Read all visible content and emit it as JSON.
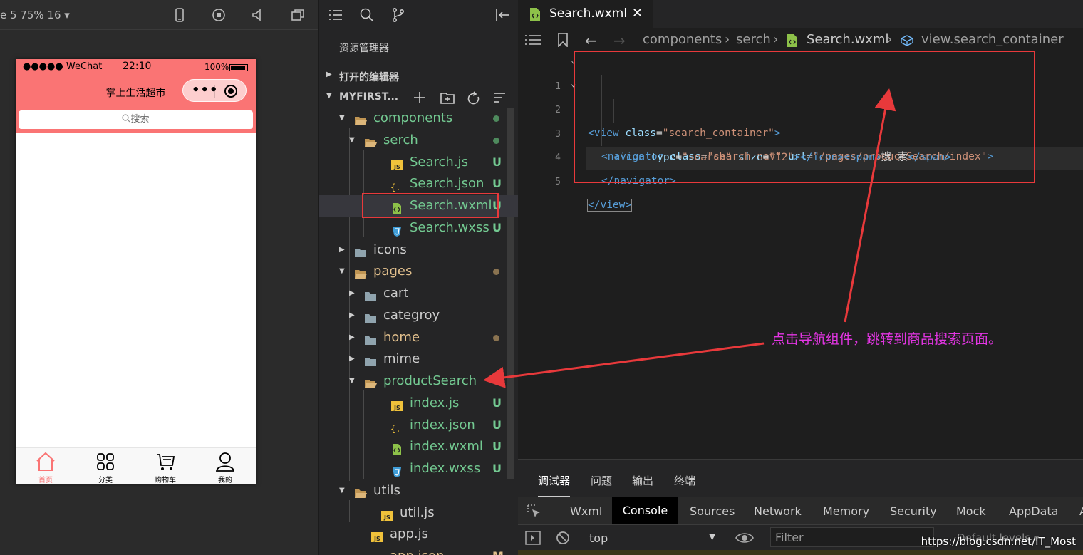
{
  "simulator": {
    "device_label": "e 5 75% 16 ▾",
    "status": {
      "carrier": "●●●●● WeChat",
      "time": "22:10",
      "battery": "100%"
    },
    "nav_title": "掌上生活超市",
    "capsule_dots": "•••",
    "search_placeholder": "搜索",
    "tabbar": [
      {
        "label": "首页",
        "icon": "home-icon",
        "active": true
      },
      {
        "label": "分类",
        "icon": "grid-icon",
        "active": false
      },
      {
        "label": "购物车",
        "icon": "cart-icon",
        "active": false
      },
      {
        "label": "我的",
        "icon": "user-icon",
        "active": false
      }
    ]
  },
  "explorer": {
    "title": "资源管理器",
    "open_editors": "打开的编辑器",
    "project": "MYFIRST...",
    "tree": [
      {
        "name": "components",
        "type": "folder-open",
        "status": "dot",
        "color": "#73c991"
      },
      {
        "name": "serch",
        "type": "folder-open",
        "status": "dot",
        "color": "#73c991"
      },
      {
        "name": "Search.js",
        "type": "js",
        "status": "U",
        "color": "#73c991"
      },
      {
        "name": "Search.json",
        "type": "json",
        "status": "U",
        "color": "#73c991"
      },
      {
        "name": "Search.wxml",
        "type": "wxml",
        "status": "U",
        "color": "#73c991"
      },
      {
        "name": "Search.wxss",
        "type": "wxss",
        "status": "U",
        "color": "#73c991"
      },
      {
        "name": "icons",
        "type": "folder",
        "status": "",
        "color": "#cccccc"
      },
      {
        "name": "pages",
        "type": "folder-open",
        "status": "dot",
        "color": "#e2c08d"
      },
      {
        "name": "cart",
        "type": "folder",
        "status": "",
        "color": "#cccccc"
      },
      {
        "name": "categroy",
        "type": "folder",
        "status": "",
        "color": "#cccccc"
      },
      {
        "name": "home",
        "type": "folder",
        "status": "dot",
        "color": "#e2c08d"
      },
      {
        "name": "mime",
        "type": "folder",
        "status": "",
        "color": "#cccccc"
      },
      {
        "name": "productSearch",
        "type": "folder-open",
        "status": "dot",
        "color": "#73c991"
      },
      {
        "name": "index.js",
        "type": "js",
        "status": "U",
        "color": "#73c991"
      },
      {
        "name": "index.json",
        "type": "json",
        "status": "U",
        "color": "#73c991"
      },
      {
        "name": "index.wxml",
        "type": "wxml",
        "status": "U",
        "color": "#73c991"
      },
      {
        "name": "index.wxss",
        "type": "wxss",
        "status": "U",
        "color": "#73c991"
      },
      {
        "name": "utils",
        "type": "folder-open",
        "status": "",
        "color": "#cccccc"
      },
      {
        "name": "util.js",
        "type": "js",
        "status": "",
        "color": "#cccccc"
      },
      {
        "name": "app.js",
        "type": "js",
        "status": "",
        "color": "#cccccc"
      },
      {
        "name": "app.json",
        "type": "json",
        "status": "M",
        "color": "#e2c08d"
      }
    ]
  },
  "editor": {
    "tab": "Search.wxml",
    "tab_close": "✕",
    "breadcrumbs": [
      "components",
      "serch",
      "Search.wxml",
      "view.search_container"
    ],
    "line_numbers": [
      "1",
      "2",
      "3",
      "4",
      "5"
    ],
    "code": {
      "l1": {
        "open": "<view",
        "attr": "class",
        "val": "\"search_container\"",
        "close": ">"
      },
      "l2": {
        "open": "<navigator",
        "attr1": "class",
        "val1": "\"search_nav\"",
        "attr2": "url",
        "val2": "\"/pages/productSearch/index\"",
        "close": ">"
      },
      "l3": {
        "open": "<icon",
        "attr1": "type",
        "val1": "\"search\"",
        "attr2": "size",
        "val2": "\"12\"",
        "mid": "></icon><span>",
        "text": "搜 索",
        "end": "</span>"
      },
      "l4": {
        "tag": "</navigator>"
      },
      "l5": {
        "tag": "</view>"
      }
    },
    "annotation": "点击导航组件，跳转到商品搜索页面。"
  },
  "devtools": {
    "tabs": [
      "调试器",
      "问题",
      "输出",
      "终端"
    ],
    "subtabs": [
      "Wxml",
      "Console",
      "Sources",
      "Network",
      "Memory",
      "Security",
      "Mock",
      "AppData",
      "A"
    ],
    "context": "top",
    "filter_placeholder": "Filter",
    "levels": "Default levels ▾"
  },
  "watermark": "https://blog.csdn.net/IT_Most",
  "colors": {
    "accent_red": "#e8393b",
    "annotation": "#e335e3",
    "untracked": "#73c991",
    "modified": "#e2c08d",
    "nav_pink": "#fa7474"
  }
}
